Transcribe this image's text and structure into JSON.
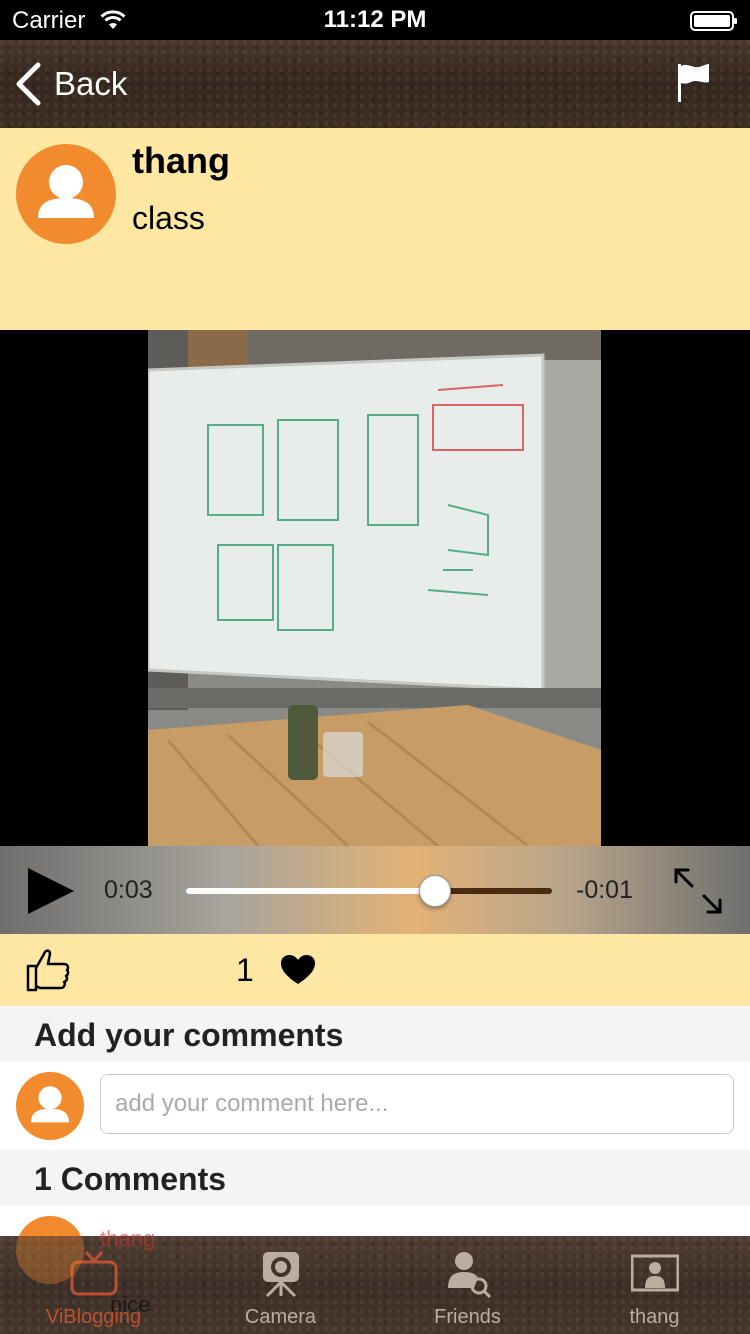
{
  "status_bar": {
    "carrier": "Carrier",
    "time": "11:12 PM"
  },
  "nav": {
    "back_label": "Back"
  },
  "post": {
    "author": "thang",
    "text": "class"
  },
  "player": {
    "elapsed": "0:03",
    "remaining": "-0:01",
    "progress": 0.68
  },
  "likes": {
    "count": "1"
  },
  "comments_section": {
    "add_heading": "Add your comments",
    "input_placeholder": "add your comment here...",
    "count_heading": "1 Comments",
    "items": [
      {
        "author": "thang",
        "text": "nice"
      }
    ]
  },
  "tab_bar": {
    "items": [
      {
        "label": "ViBlogging",
        "icon": "tv-icon",
        "active": true
      },
      {
        "label": "Camera",
        "icon": "camera-icon",
        "active": false
      },
      {
        "label": "Friends",
        "icon": "friends-search-icon",
        "active": false
      },
      {
        "label": "thang",
        "icon": "profile-icon",
        "active": false
      }
    ]
  },
  "colors": {
    "header_bg": "#fde7a3",
    "avatar_orange": "#f28a2e",
    "leather": "#3b2c23",
    "comment_author": "#d0342c"
  }
}
